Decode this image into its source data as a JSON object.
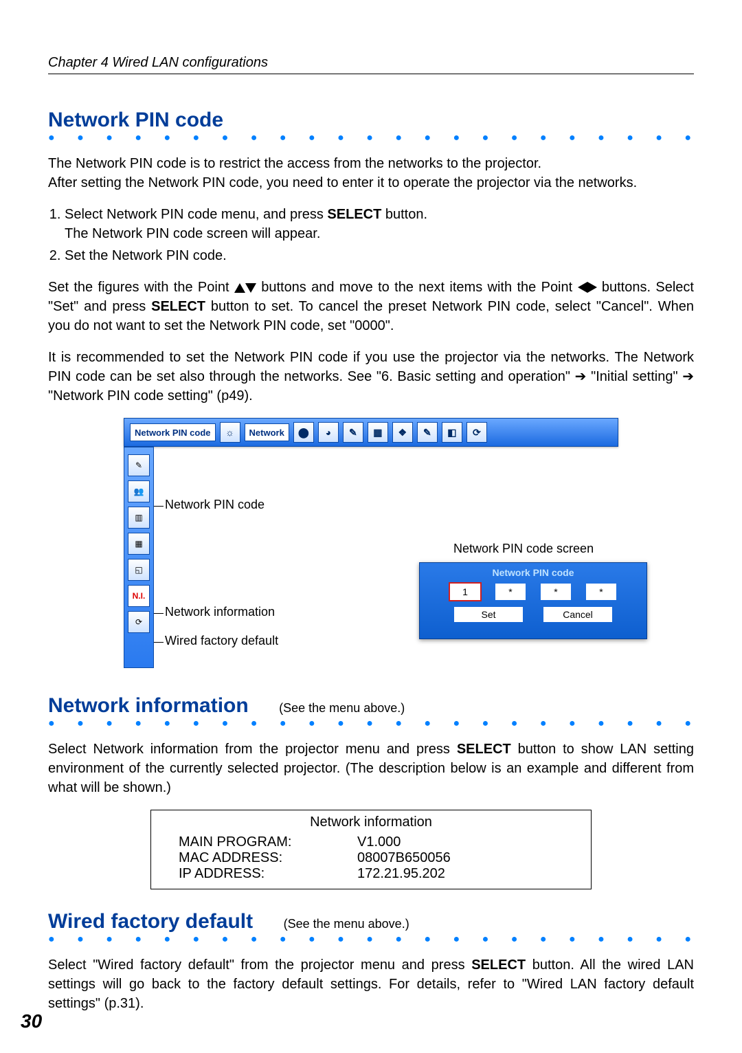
{
  "chapter": "Chapter 4 Wired LAN configurations",
  "page_number": "30",
  "sec1": {
    "title": "Network PIN code",
    "p1": "The Network PIN code is to restrict the access from the networks to the projector.",
    "p2": "After setting the Network PIN code, you need to enter it to operate the projector via the networks.",
    "step1_a": "Select Network PIN code menu, and press ",
    "step1_b": "SELECT",
    "step1_c": " button.",
    "step1_sub": "The Network PIN code screen will appear.",
    "step2": "Set the Network PIN code.",
    "para3_a": "Set the figures with the Point ",
    "para3_b": " buttons and move to the next items with the Point ",
    "para3_c": " buttons.  Select \"Set\" and press ",
    "para3_select": "SELECT",
    "para3_d": " button to set.  To cancel the preset Network PIN code, select \"Cancel\". When you do not want to set the Network PIN code, set \"0000\".",
    "para4_a": "It is recommended to set the Network PIN code if you use the projector via the networks.  The Network PIN code can be set also through the networks. See \"6. Basic setting and operation\" ",
    "para4_arrow": "➔",
    "para4_b": " \"Initial setting\" ",
    "para4_c": " \"Network PIN code setting\" (p49)."
  },
  "menu": {
    "tab1": "Network PIN code",
    "tab2": "Network",
    "callout_pin": "Network PIN code",
    "callout_info": "Network information",
    "callout_default": "Wired factory default",
    "screen_label": "Network PIN code screen",
    "screen_title": "Network PIN code",
    "digit": "1",
    "star": "*",
    "btn_set": "Set",
    "btn_cancel": "Cancel"
  },
  "sec2": {
    "title": "Network information",
    "note": "(See the menu above.)",
    "body_a": "Select Network information from the projector menu and press ",
    "body_select": "SELECT",
    "body_b": " button to show LAN setting environment of the currently selected projector. (The description below is an example and different from what will be shown.)",
    "table": {
      "title": "Network information",
      "rows": [
        {
          "k": "MAIN PROGRAM:",
          "v": "V1.000"
        },
        {
          "k": "MAC ADDRESS:",
          "v": "08007B650056"
        },
        {
          "k": "IP ADDRESS:",
          "v": "172.21.95.202"
        }
      ]
    }
  },
  "sec3": {
    "title": "Wired factory default",
    "note": "(See the menu above.)",
    "body_a": "Select \"Wired factory default\" from the projector menu and press ",
    "body_select": "SELECT",
    "body_b": " button.  All the wired LAN settings will go back to the factory default settings. For details, refer to \"Wired LAN factory default settings\" (p.31)."
  }
}
